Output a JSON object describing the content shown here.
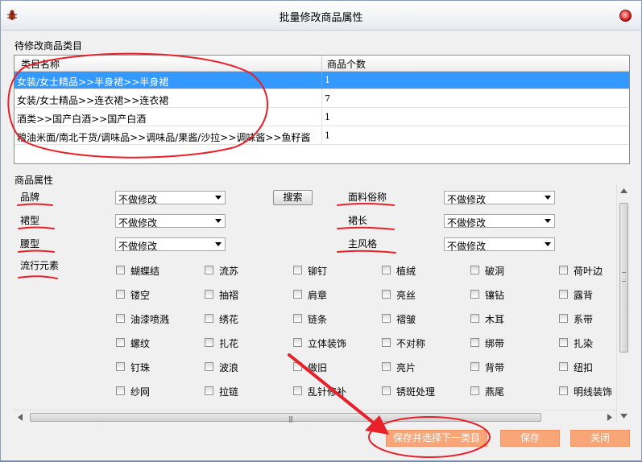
{
  "window": {
    "title": "批量修改商品属性"
  },
  "categories": {
    "label": "待修改商品类目",
    "columns": {
      "name": "类目名称",
      "count": "商品个数"
    },
    "rows": [
      {
        "name": "女装/女士精品>>半身裙>>半身裙",
        "count": "1"
      },
      {
        "name": "女装/女士精品>>连衣裙>>连衣裙",
        "count": "7"
      },
      {
        "name": "酒类>>国产白酒>>国产白酒",
        "count": "1"
      },
      {
        "name": "粮油米面/南北干货/调味品>>调味品/果酱/沙拉>>调味酱>>鱼籽酱",
        "count": "1"
      }
    ]
  },
  "attributes": {
    "label": "商品属性",
    "brand": {
      "label": "品牌",
      "value": "不做修改"
    },
    "skirt_type": {
      "label": "裙型",
      "value": "不做修改"
    },
    "waist_type": {
      "label": "腰型",
      "value": "不做修改"
    },
    "fabric": {
      "label": "面料俗称",
      "value": "不做修改"
    },
    "skirt_length": {
      "label": "裙长",
      "value": "不做修改"
    },
    "main_style": {
      "label": "主风格",
      "value": "不做修改"
    },
    "popular_label": "流行元素",
    "search_label": "搜索",
    "elements": [
      [
        "蝴蝶结",
        "流苏",
        "铆钉",
        "植绒",
        "破洞",
        "荷叶边"
      ],
      [
        "镂空",
        "抽褶",
        "肩章",
        "亮丝",
        "镶钻",
        "露背"
      ],
      [
        "油漆喷溅",
        "绣花",
        "链条",
        "褶皱",
        "木耳",
        "系带"
      ],
      [
        "螺纹",
        "扎花",
        "立体装饰",
        "不对称",
        "绑带",
        "扎染"
      ],
      [
        "钉珠",
        "波浪",
        "做旧",
        "亮片",
        "背带",
        "纽扣"
      ],
      [
        "纱网",
        "拉链",
        "乱针修补",
        "锈斑处理",
        "燕尾",
        "明线装饰"
      ]
    ]
  },
  "buttons": {
    "save_next": "保存并选择下一类目",
    "save": "保存",
    "close": "关闭"
  },
  "colors": {
    "accent_button": "#f8a578",
    "selected_row": "#3399ff",
    "annotation": "#e8202a"
  }
}
